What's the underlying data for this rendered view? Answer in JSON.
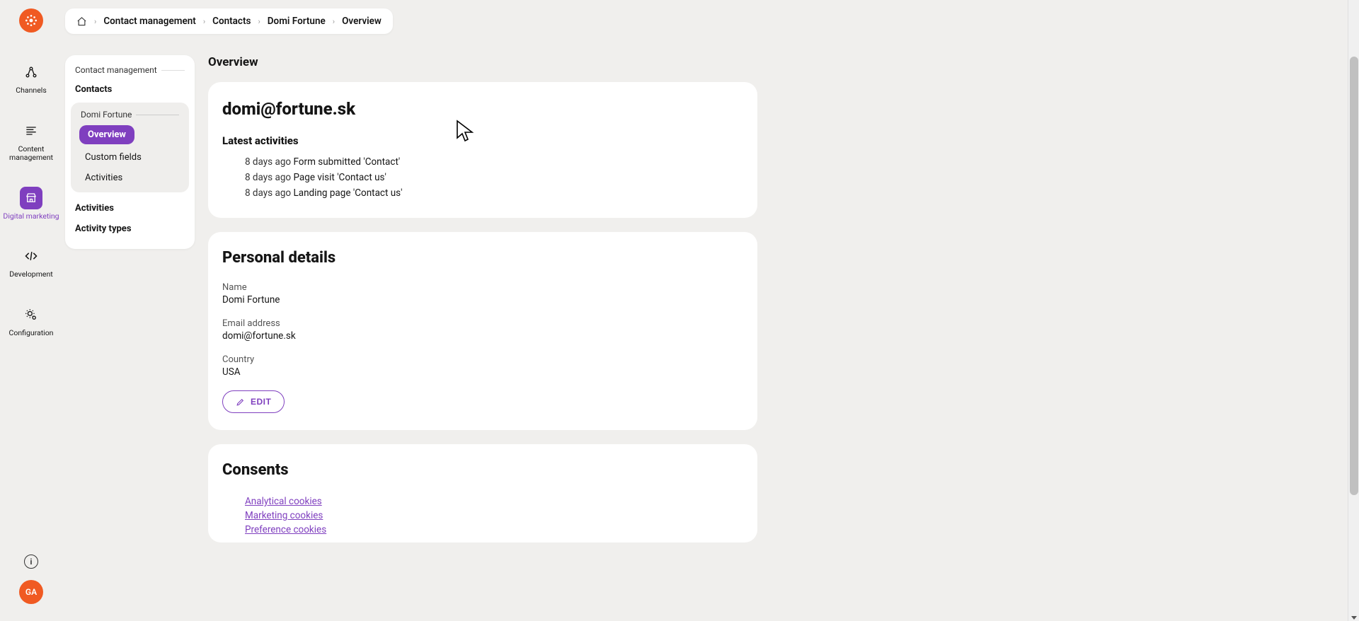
{
  "breadcrumbs": {
    "items": [
      "Contact management",
      "Contacts",
      "Domi Fortune",
      "Overview"
    ]
  },
  "rail": {
    "channels": "Channels",
    "content": "Content management",
    "digital": "Digital marketing",
    "development": "Development",
    "configuration": "Configuration",
    "avatar": "GA"
  },
  "sidebar": {
    "title": "Contact management",
    "contacts": "Contacts",
    "sub_title": "Domi Fortune",
    "overview": "Overview",
    "custom_fields": "Custom fields",
    "activities": "Activities",
    "activities2": "Activities",
    "activity_types": "Activity types"
  },
  "main": {
    "heading": "Overview",
    "email": "domi@fortune.sk",
    "latest_activities_title": "Latest activities",
    "activities": [
      {
        "time": "8 days ago",
        "text": "Form submitted 'Contact'"
      },
      {
        "time": "8 days ago",
        "text": "Page visit 'Contact us'"
      },
      {
        "time": "8 days ago",
        "text": "Landing page 'Contact us'"
      }
    ],
    "personal_title": "Personal details",
    "fields": {
      "name_label": "Name",
      "name_value": "Domi Fortune",
      "email_label": "Email address",
      "email_value": "domi@fortune.sk",
      "country_label": "Country",
      "country_value": "USA"
    },
    "edit_label": "EDIT",
    "consents_title": "Consents",
    "consents": [
      "Analytical cookies",
      "Marketing cookies",
      "Preference cookies"
    ]
  }
}
